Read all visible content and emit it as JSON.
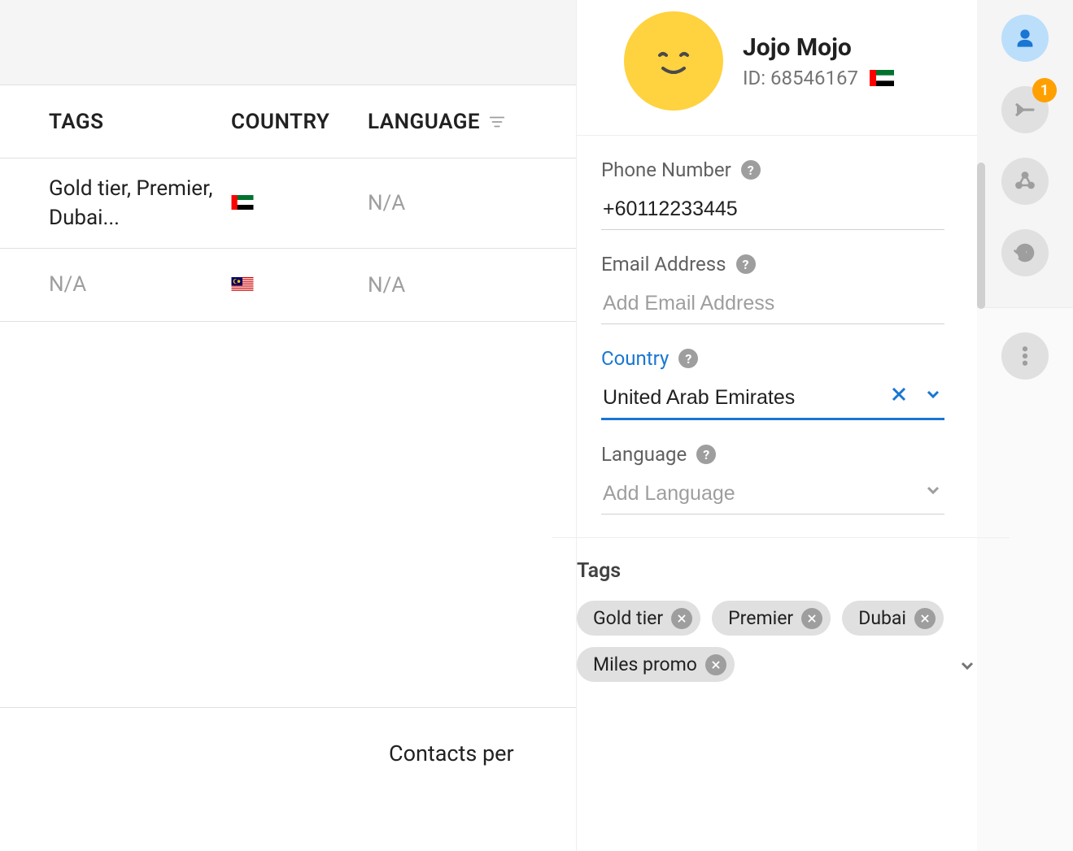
{
  "table": {
    "headers": {
      "tags": "TAGS",
      "country": "COUNTRY",
      "language": "LANGUAGE"
    },
    "rows": [
      {
        "tags": "Gold tier, Premier, Dubai...",
        "country_flag": "uae",
        "language": "N/A"
      },
      {
        "tags": "N/A",
        "country_flag": "my",
        "language": "N/A"
      }
    ]
  },
  "footer": {
    "contacts_per": "Contacts per"
  },
  "rail": {
    "badge_count": "1"
  },
  "panel": {
    "name": "Jojo Mojo",
    "id_label": "ID: 68546167",
    "country_flag": "uae",
    "fields": {
      "phone": {
        "label": "Phone Number",
        "value": "+60112233445"
      },
      "email": {
        "label": "Email Address",
        "placeholder": "Add Email Address",
        "value": ""
      },
      "country": {
        "label": "Country",
        "value": "United Arab Emirates"
      },
      "language": {
        "label": "Language",
        "placeholder": "Add Language",
        "value": ""
      }
    },
    "tags_title": "Tags",
    "tags": [
      "Gold tier",
      "Premier",
      "Dubai",
      "Miles promo"
    ]
  }
}
